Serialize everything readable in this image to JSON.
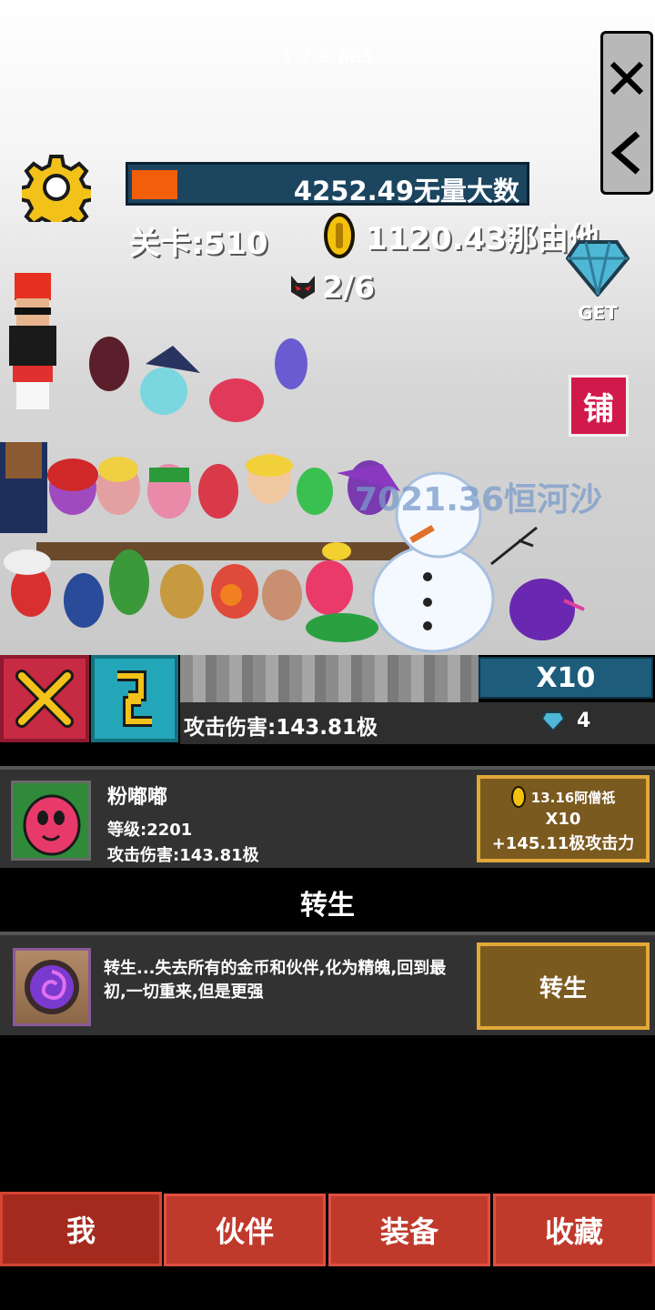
{
  "version": "1.7.6:665",
  "side_buttons": {
    "close_icon": "close-x-icon",
    "back_icon": "chevron-left-icon"
  },
  "hud": {
    "hp_value": "4252.49无量大数",
    "hp_fraction": 0.1,
    "stage_label": "关卡:510",
    "coins": "1120.43那由他",
    "demon_count": "2/6",
    "get_label": "GET",
    "shop_label": "铺",
    "floating_damage": "7021.36恒河沙"
  },
  "controls": {
    "multiplier_label": "X10",
    "attack_label": "攻击伤害:143.81极",
    "gem_count": "4"
  },
  "partner": {
    "name": "粉嘟嘟",
    "level": "等级:2201",
    "attack": "攻击伤害:143.81极",
    "upgrade_cost": "13.16阿僧祇",
    "upgrade_multiplier": "X10",
    "upgrade_gain": "+145.11极攻击力"
  },
  "rebirth": {
    "section_title": "转生",
    "description": "转生...失去所有的金币和伙伴,化为精魄,回到最初,一切重来,但是更强",
    "button_label": "转生"
  },
  "tabs": [
    {
      "label": "我",
      "active": true
    },
    {
      "label": "伙伴",
      "active": false
    },
    {
      "label": "装备",
      "active": false
    },
    {
      "label": "收藏",
      "active": false
    }
  ],
  "colors": {
    "accent_red": "#c03a2c",
    "hp_orange": "#f25e0a",
    "gold_border": "#e2a838"
  }
}
